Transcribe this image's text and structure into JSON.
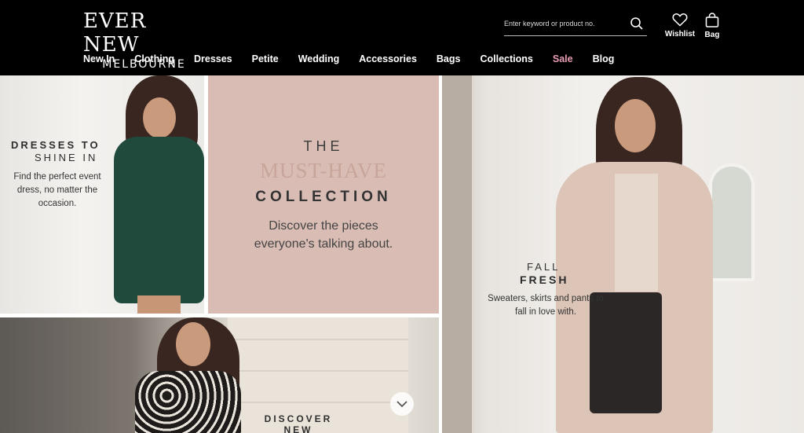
{
  "brand": {
    "name": "EVER NEW",
    "sub": "MELBOURNE"
  },
  "search": {
    "placeholder": "Enter keyword or product no."
  },
  "header_icons": {
    "wishlist": "Wishlist",
    "bag": "Bag"
  },
  "nav": [
    "New In",
    "Clothing",
    "Dresses",
    "Petite",
    "Wedding",
    "Accessories",
    "Bags",
    "Collections",
    "Sale",
    "Blog"
  ],
  "colors": {
    "header_bg": "#000000",
    "sale": "#e79db4",
    "must_have_bg": "#d9bdb4"
  },
  "panels": {
    "dresses": {
      "title_line1": "DRESSES TO",
      "title_line2": "SHINE IN",
      "desc": "Find the perfect event dress, no matter the occasion."
    },
    "must_have": {
      "the": "THE",
      "must": "MUST-HAVE",
      "collection": "COLLECTION",
      "desc": "Discover the pieces everyone's talking about."
    },
    "fall": {
      "line1": "FALL",
      "line2": "FRESH",
      "desc": "Sweaters, skirts and pants to fall in love with."
    },
    "discover": {
      "title": "DISCOVER NEW"
    }
  },
  "icons": {
    "search": "search-icon",
    "wishlist": "heart-icon",
    "bag": "bag-icon",
    "scroll": "chevron-down-icon"
  }
}
